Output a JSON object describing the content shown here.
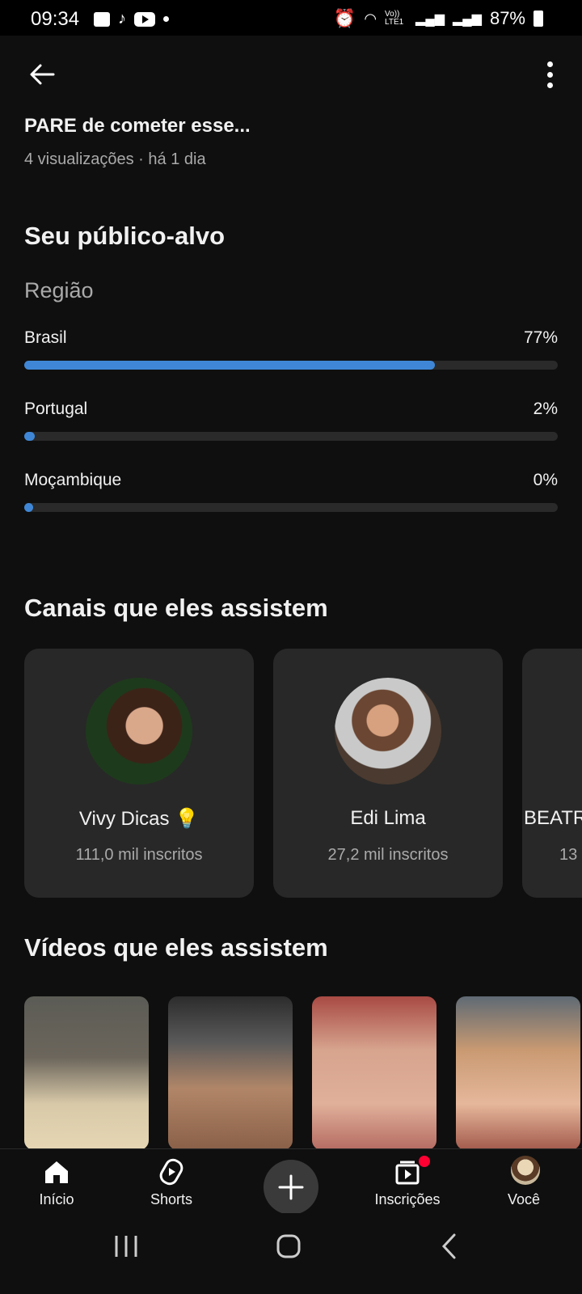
{
  "status_bar": {
    "time": "09:34",
    "wifi_label": "Vo)) LTE1",
    "battery": "87%"
  },
  "video": {
    "title": "PARE de cometer esse...",
    "meta": "4 visualizações · há 1 dia"
  },
  "audience": {
    "heading": "Seu público-alvo",
    "region_label": "Região",
    "regions": [
      {
        "name": "Brasil",
        "percent_text": "77%",
        "value": 0.77
      },
      {
        "name": "Portugal",
        "percent_text": "2%",
        "value": 0.02
      },
      {
        "name": "Moçambique",
        "percent_text": "0%",
        "value": 0.0
      }
    ]
  },
  "channels": {
    "heading": "Canais que eles assistem",
    "items": [
      {
        "name": "Vivy Dicas 💡",
        "subs": "111,0 mil inscritos"
      },
      {
        "name": "Edi Lima",
        "subs": "27,2 mil inscritos"
      },
      {
        "name": "BEATR",
        "subs": "13"
      }
    ]
  },
  "videos": {
    "heading": "Vídeos que eles assistem"
  },
  "bottom_nav": {
    "items": [
      {
        "label": "Início",
        "icon": "home-icon"
      },
      {
        "label": "Shorts",
        "icon": "shorts-icon"
      },
      {
        "label": "",
        "icon": "plus-icon"
      },
      {
        "label": "Inscrições",
        "icon": "subscriptions-icon"
      },
      {
        "label": "Você",
        "icon": "avatar"
      }
    ]
  },
  "colors": {
    "background": "#0f0f0f",
    "bar_fill": "#3f87d6",
    "bar_track": "#2a2a2a",
    "card": "#282828",
    "notification": "#ff0033"
  }
}
